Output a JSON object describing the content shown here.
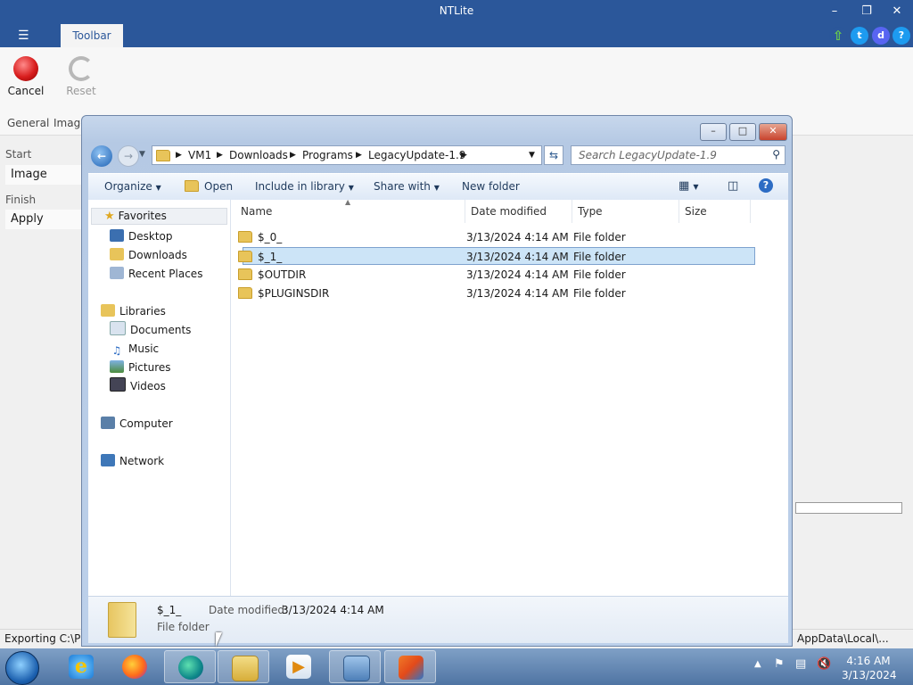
{
  "app": {
    "title": "NTLite",
    "tab": "Toolbar",
    "ribbon": {
      "cancel": "Cancel",
      "reset": "Reset",
      "groups": [
        "General",
        "Image"
      ]
    },
    "left": {
      "start_section": "Start",
      "image_item": "Image",
      "finish_section": "Finish",
      "apply_item": "Apply"
    },
    "status": {
      "left": "Exporting C:\\Pro",
      "right": "AppData\\Local\\..."
    }
  },
  "explorer": {
    "breadcrumb": [
      "VM1",
      "Downloads",
      "Programs",
      "LegacyUpdate-1.9"
    ],
    "search_placeholder": "Search LegacyUpdate-1.9",
    "commands": {
      "organize": "Organize",
      "open": "Open",
      "include": "Include in library",
      "share": "Share with",
      "new_folder": "New folder"
    },
    "nav": {
      "favorites": "Favorites",
      "favorites_items": [
        "Desktop",
        "Downloads",
        "Recent Places"
      ],
      "libraries": "Libraries",
      "libraries_items": [
        "Documents",
        "Music",
        "Pictures",
        "Videos"
      ],
      "computer": "Computer",
      "network": "Network"
    },
    "columns": {
      "name": "Name",
      "date": "Date modified",
      "type": "Type",
      "size": "Size"
    },
    "files": [
      {
        "name": "$_0_",
        "date": "3/13/2024 4:14 AM",
        "type": "File folder"
      },
      {
        "name": "$_1_",
        "date": "3/13/2024 4:14 AM",
        "type": "File folder"
      },
      {
        "name": "$OUTDIR",
        "date": "3/13/2024 4:14 AM",
        "type": "File folder"
      },
      {
        "name": "$PLUGINSDIR",
        "date": "3/13/2024 4:14 AM",
        "type": "File folder"
      }
    ],
    "details": {
      "name": "$_1_",
      "type": "File folder",
      "date_label": "Date modified:",
      "date_value": "3/13/2024 4:14 AM"
    }
  },
  "taskbar": {
    "time": "4:16 AM",
    "date": "3/13/2024"
  }
}
